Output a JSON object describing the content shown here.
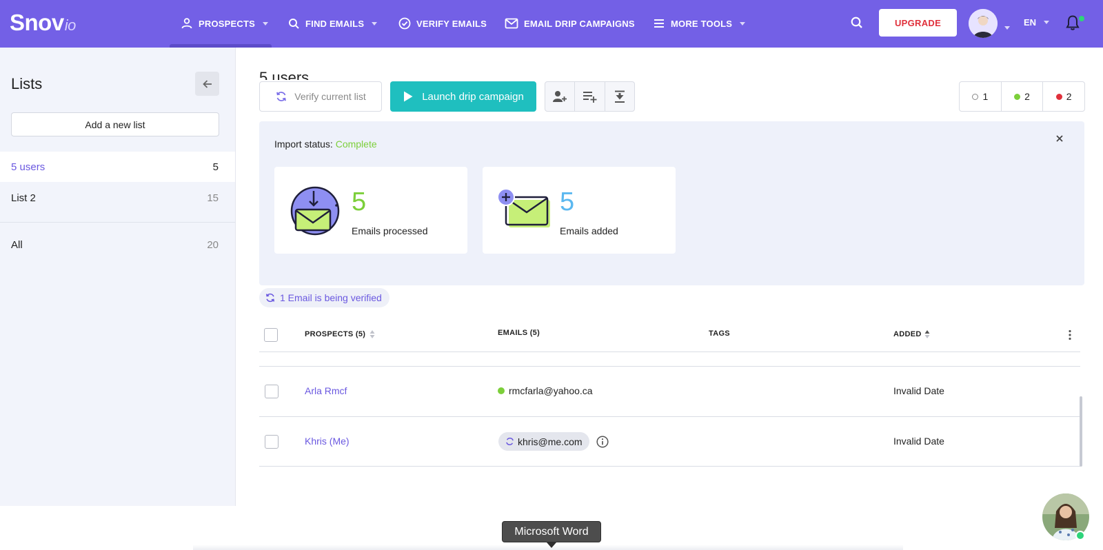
{
  "app": {
    "logo_main": "Snov",
    "logo_suffix": "io"
  },
  "nav": {
    "prospects": "PROSPECTS",
    "find_emails": "FIND EMAILS",
    "verify_emails": "VERIFY EMAILS",
    "drip_campaigns": "EMAIL DRIP CAMPAIGNS",
    "more_tools": "MORE TOOLS",
    "upgrade": "UPGRADE",
    "language": "EN"
  },
  "sidebar": {
    "title": "Lists",
    "add_list": "Add a new list",
    "lists": [
      {
        "label": "5 users",
        "count": "5",
        "active": true
      },
      {
        "label": "List 2",
        "count": "15",
        "active": false
      }
    ],
    "all": {
      "label": "All",
      "count": "20"
    }
  },
  "main": {
    "title": "5 users",
    "verify_label": "Verify current list",
    "launch_label": "Launch drip campaign",
    "status_counts": {
      "unverified": "1",
      "valid": "2",
      "invalid": "2"
    },
    "status_colors": {
      "unverified": "#888888",
      "valid": "#7ccf3a",
      "invalid": "#e0303b"
    }
  },
  "import": {
    "label": "Import status:",
    "status": "Complete",
    "processed": {
      "value": "5",
      "label": "Emails processed"
    },
    "added": {
      "value": "5",
      "label": "Emails added"
    }
  },
  "verifying": {
    "label": "1 Email is being verified"
  },
  "table": {
    "headers": {
      "prospects": "PROSPECTS (5)",
      "emails": "EMAILS (5)",
      "tags": "TAGS",
      "added": "ADDED"
    },
    "rows": [
      {
        "name": "Arla Rmcf",
        "email": "rmcfarla@yahoo.ca",
        "email_status": "valid",
        "tags": "",
        "added": "Invalid Date"
      },
      {
        "name": "Khris (Me)",
        "email": "khris@me.com",
        "email_status": "verifying",
        "tags": "",
        "added": "Invalid Date"
      }
    ]
  },
  "taskbar": {
    "tooltip": "Microsoft Word"
  },
  "colors": {
    "brand": "#7360e6",
    "accent_teal": "#1fbfbf",
    "link": "#6a58e0"
  }
}
